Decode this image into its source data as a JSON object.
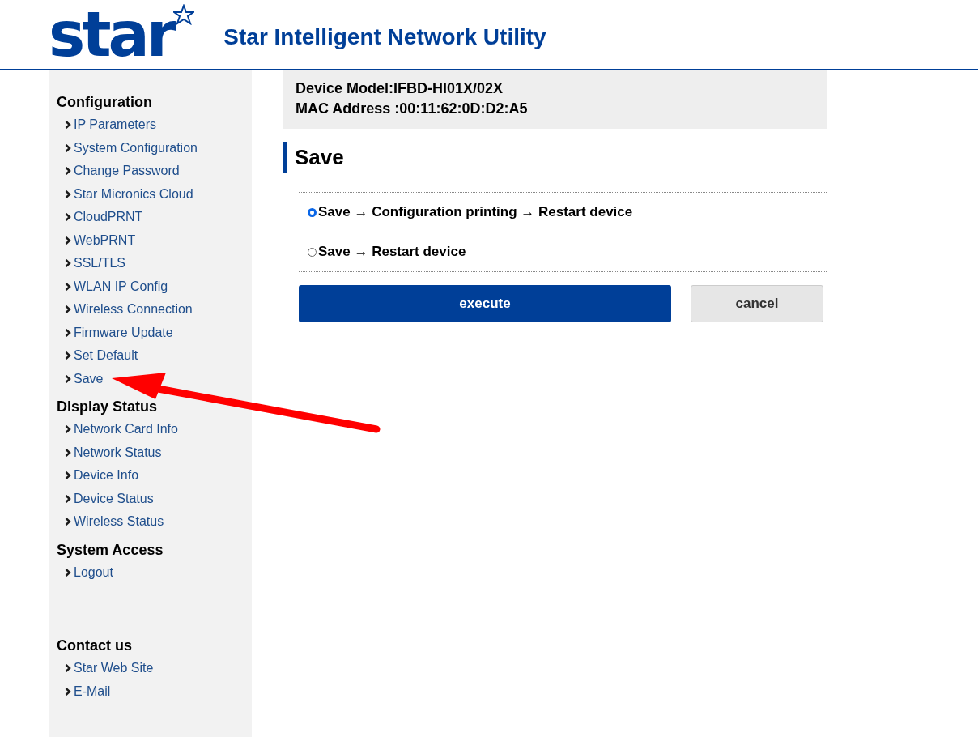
{
  "header": {
    "logo": "star",
    "title": "Star Intelligent Network Utility"
  },
  "sidebar": {
    "sections": [
      {
        "heading": "Configuration",
        "items": [
          "IP Parameters",
          "System Configuration",
          "Change Password",
          "Star Micronics Cloud",
          "CloudPRNT",
          "WebPRNT",
          "SSL/TLS",
          "WLAN IP Config",
          "Wireless Connection",
          "Firmware Update",
          "Set Default",
          "Save"
        ]
      },
      {
        "heading": "Display Status",
        "items": [
          "Network Card Info",
          "Network Status",
          "Device Info",
          "Device Status",
          "Wireless Status"
        ]
      },
      {
        "heading": "System Access",
        "items": [
          "Logout"
        ]
      },
      {
        "heading": "Contact us",
        "items": [
          "Star Web Site",
          "E-Mail"
        ]
      }
    ]
  },
  "device": {
    "model": "Device Model:IFBD-HI01X/02X",
    "mac": "MAC Address :00:11:62:0D:D2:A5"
  },
  "page_title": "Save",
  "options": [
    {
      "label": "Save → Configuration printing → Restart device",
      "selected": true
    },
    {
      "label": "Save → Restart device",
      "selected": false
    }
  ],
  "buttons": {
    "execute": "execute",
    "cancel": "cancel"
  }
}
